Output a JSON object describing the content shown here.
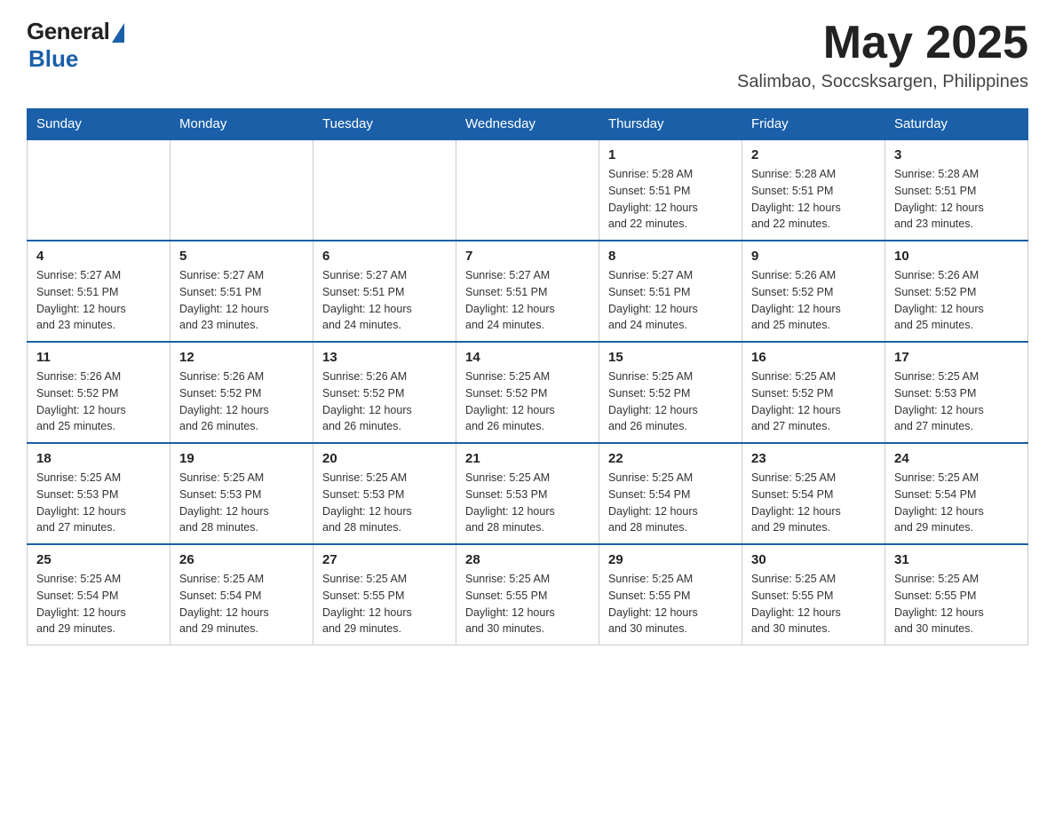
{
  "header": {
    "logo": {
      "general": "General",
      "blue": "Blue"
    },
    "month_year": "May 2025",
    "location": "Salimbao, Soccsksargen, Philippines"
  },
  "days_of_week": [
    "Sunday",
    "Monday",
    "Tuesday",
    "Wednesday",
    "Thursday",
    "Friday",
    "Saturday"
  ],
  "weeks": [
    [
      {
        "day": "",
        "info": ""
      },
      {
        "day": "",
        "info": ""
      },
      {
        "day": "",
        "info": ""
      },
      {
        "day": "",
        "info": ""
      },
      {
        "day": "1",
        "info": "Sunrise: 5:28 AM\nSunset: 5:51 PM\nDaylight: 12 hours\nand 22 minutes."
      },
      {
        "day": "2",
        "info": "Sunrise: 5:28 AM\nSunset: 5:51 PM\nDaylight: 12 hours\nand 22 minutes."
      },
      {
        "day": "3",
        "info": "Sunrise: 5:28 AM\nSunset: 5:51 PM\nDaylight: 12 hours\nand 23 minutes."
      }
    ],
    [
      {
        "day": "4",
        "info": "Sunrise: 5:27 AM\nSunset: 5:51 PM\nDaylight: 12 hours\nand 23 minutes."
      },
      {
        "day": "5",
        "info": "Sunrise: 5:27 AM\nSunset: 5:51 PM\nDaylight: 12 hours\nand 23 minutes."
      },
      {
        "day": "6",
        "info": "Sunrise: 5:27 AM\nSunset: 5:51 PM\nDaylight: 12 hours\nand 24 minutes."
      },
      {
        "day": "7",
        "info": "Sunrise: 5:27 AM\nSunset: 5:51 PM\nDaylight: 12 hours\nand 24 minutes."
      },
      {
        "day": "8",
        "info": "Sunrise: 5:27 AM\nSunset: 5:51 PM\nDaylight: 12 hours\nand 24 minutes."
      },
      {
        "day": "9",
        "info": "Sunrise: 5:26 AM\nSunset: 5:52 PM\nDaylight: 12 hours\nand 25 minutes."
      },
      {
        "day": "10",
        "info": "Sunrise: 5:26 AM\nSunset: 5:52 PM\nDaylight: 12 hours\nand 25 minutes."
      }
    ],
    [
      {
        "day": "11",
        "info": "Sunrise: 5:26 AM\nSunset: 5:52 PM\nDaylight: 12 hours\nand 25 minutes."
      },
      {
        "day": "12",
        "info": "Sunrise: 5:26 AM\nSunset: 5:52 PM\nDaylight: 12 hours\nand 26 minutes."
      },
      {
        "day": "13",
        "info": "Sunrise: 5:26 AM\nSunset: 5:52 PM\nDaylight: 12 hours\nand 26 minutes."
      },
      {
        "day": "14",
        "info": "Sunrise: 5:25 AM\nSunset: 5:52 PM\nDaylight: 12 hours\nand 26 minutes."
      },
      {
        "day": "15",
        "info": "Sunrise: 5:25 AM\nSunset: 5:52 PM\nDaylight: 12 hours\nand 26 minutes."
      },
      {
        "day": "16",
        "info": "Sunrise: 5:25 AM\nSunset: 5:52 PM\nDaylight: 12 hours\nand 27 minutes."
      },
      {
        "day": "17",
        "info": "Sunrise: 5:25 AM\nSunset: 5:53 PM\nDaylight: 12 hours\nand 27 minutes."
      }
    ],
    [
      {
        "day": "18",
        "info": "Sunrise: 5:25 AM\nSunset: 5:53 PM\nDaylight: 12 hours\nand 27 minutes."
      },
      {
        "day": "19",
        "info": "Sunrise: 5:25 AM\nSunset: 5:53 PM\nDaylight: 12 hours\nand 28 minutes."
      },
      {
        "day": "20",
        "info": "Sunrise: 5:25 AM\nSunset: 5:53 PM\nDaylight: 12 hours\nand 28 minutes."
      },
      {
        "day": "21",
        "info": "Sunrise: 5:25 AM\nSunset: 5:53 PM\nDaylight: 12 hours\nand 28 minutes."
      },
      {
        "day": "22",
        "info": "Sunrise: 5:25 AM\nSunset: 5:54 PM\nDaylight: 12 hours\nand 28 minutes."
      },
      {
        "day": "23",
        "info": "Sunrise: 5:25 AM\nSunset: 5:54 PM\nDaylight: 12 hours\nand 29 minutes."
      },
      {
        "day": "24",
        "info": "Sunrise: 5:25 AM\nSunset: 5:54 PM\nDaylight: 12 hours\nand 29 minutes."
      }
    ],
    [
      {
        "day": "25",
        "info": "Sunrise: 5:25 AM\nSunset: 5:54 PM\nDaylight: 12 hours\nand 29 minutes."
      },
      {
        "day": "26",
        "info": "Sunrise: 5:25 AM\nSunset: 5:54 PM\nDaylight: 12 hours\nand 29 minutes."
      },
      {
        "day": "27",
        "info": "Sunrise: 5:25 AM\nSunset: 5:55 PM\nDaylight: 12 hours\nand 29 minutes."
      },
      {
        "day": "28",
        "info": "Sunrise: 5:25 AM\nSunset: 5:55 PM\nDaylight: 12 hours\nand 30 minutes."
      },
      {
        "day": "29",
        "info": "Sunrise: 5:25 AM\nSunset: 5:55 PM\nDaylight: 12 hours\nand 30 minutes."
      },
      {
        "day": "30",
        "info": "Sunrise: 5:25 AM\nSunset: 5:55 PM\nDaylight: 12 hours\nand 30 minutes."
      },
      {
        "day": "31",
        "info": "Sunrise: 5:25 AM\nSunset: 5:55 PM\nDaylight: 12 hours\nand 30 minutes."
      }
    ]
  ]
}
